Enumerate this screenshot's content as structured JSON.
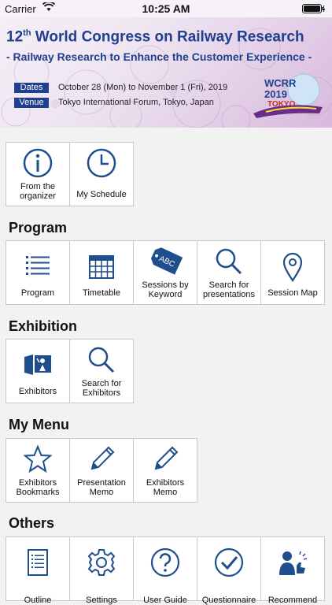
{
  "status_bar": {
    "carrier": "Carrier",
    "time": "10:25 AM"
  },
  "banner": {
    "title_prefix": "12",
    "title_sup": "th",
    "title_rest": " World Congress on Railway Research",
    "subtitle": "- Railway Research to Enhance the Customer Experience -",
    "dates_tag": "Dates",
    "dates_value": "October 28 (Mon) to November 1 (Fri), 2019",
    "venue_tag": "Venue",
    "venue_value": "Tokyo International Forum, Tokyo, Japan",
    "logo_line1": "WCRR",
    "logo_line2": "2019",
    "logo_line3": "TOKYO"
  },
  "top": {
    "items": [
      {
        "label": "From the organizer",
        "icon": "info-icon"
      },
      {
        "label": "My Schedule",
        "icon": "clock-icon"
      }
    ]
  },
  "program": {
    "title": "Program",
    "items": [
      {
        "label": "Program",
        "icon": "list-icon"
      },
      {
        "label": "Timetable",
        "icon": "calendar-icon"
      },
      {
        "label": "Sessions by Keyword",
        "icon": "tag-icon",
        "tag_text": "ABC"
      },
      {
        "label": "Search for presentations",
        "icon": "search-icon"
      },
      {
        "label": "Session Map",
        "icon": "map-pin-icon"
      }
    ]
  },
  "exhibition": {
    "title": "Exhibition",
    "items": [
      {
        "label": "Exhibitors",
        "icon": "exhibitor-icon"
      },
      {
        "label": "Search for Exhibitors",
        "icon": "search-icon"
      }
    ]
  },
  "my_menu": {
    "title": "My Menu",
    "items": [
      {
        "label": "Exhibitors Bookmarks",
        "icon": "star-icon"
      },
      {
        "label": "Presentation Memo",
        "icon": "pencil-icon"
      },
      {
        "label": "Exhibitors Memo",
        "icon": "pencil-icon"
      }
    ]
  },
  "others": {
    "title": "Others",
    "items": [
      {
        "label": "Outline",
        "icon": "document-icon"
      },
      {
        "label": "Settings",
        "icon": "gear-icon"
      },
      {
        "label": "User Guide",
        "icon": "help-icon"
      },
      {
        "label": "Questionnaire",
        "icon": "check-icon"
      },
      {
        "label": "Recommend",
        "icon": "recommend-icon"
      }
    ]
  },
  "colors": {
    "icon": "#1f4e8c",
    "brand": "#1f3f8f"
  }
}
